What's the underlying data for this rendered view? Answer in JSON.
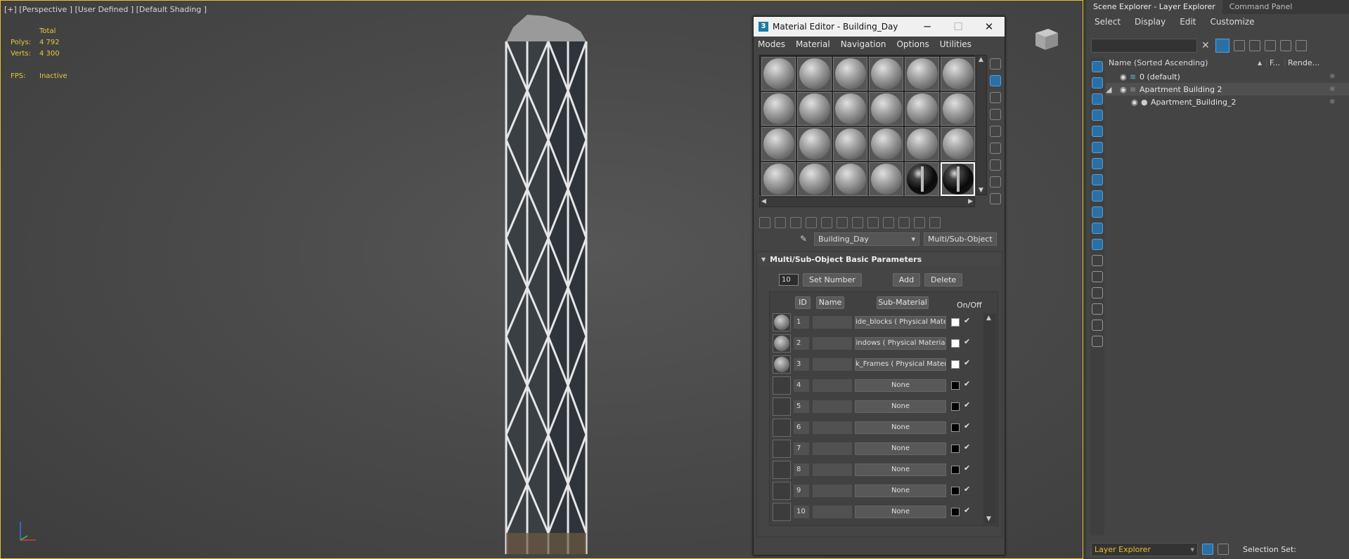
{
  "viewport": {
    "label": "[+] [Perspective ] [User Defined ] [Default Shading ]",
    "stats": {
      "total_label": "Total",
      "polys_label": "Polys:",
      "polys_value": "4 792",
      "verts_label": "Verts:",
      "verts_value": "4 300",
      "fps_label": "FPS:",
      "fps_value": "Inactive"
    }
  },
  "material_editor": {
    "title": "Material Editor - Building_Day",
    "logo": "3",
    "menu": [
      "Modes",
      "Material",
      "Navigation",
      "Options",
      "Utilities"
    ],
    "material_name": "Building_Day",
    "material_type": "Multi/Sub-Object",
    "rollout_title": "Multi/Sub-Object Basic Parameters",
    "set_number_value": "10",
    "set_number_label": "Set Number",
    "add_label": "Add",
    "delete_label": "Delete",
    "columns": {
      "id": "ID",
      "name": "Name",
      "sub_material": "Sub-Material",
      "on_off": "On/Off"
    },
    "rows": [
      {
        "id": "1",
        "sub": "ide_blocks  ( Physical Mater",
        "color": "#ffffff",
        "has_ball": true
      },
      {
        "id": "2",
        "sub": "indows  ( Physical Materia",
        "color": "#ffffff",
        "has_ball": true
      },
      {
        "id": "3",
        "sub": "k_Frames  ( Physical Mater",
        "color": "#ffffff",
        "has_ball": true
      },
      {
        "id": "4",
        "sub": "None",
        "color": "#000000",
        "has_ball": false
      },
      {
        "id": "5",
        "sub": "None",
        "color": "#000000",
        "has_ball": false
      },
      {
        "id": "6",
        "sub": "None",
        "color": "#000000",
        "has_ball": false
      },
      {
        "id": "7",
        "sub": "None",
        "color": "#000000",
        "has_ball": false
      },
      {
        "id": "8",
        "sub": "None",
        "color": "#000000",
        "has_ball": false
      },
      {
        "id": "9",
        "sub": "None",
        "color": "#000000",
        "has_ball": false
      },
      {
        "id": "10",
        "sub": "None",
        "color": "#000000",
        "has_ball": false
      }
    ],
    "check_glyph": "✔"
  },
  "scene_explorer": {
    "tabs": [
      "Scene Explorer - Layer Explorer",
      "Command Panel"
    ],
    "menu": [
      "Select",
      "Display",
      "Edit",
      "Customize"
    ],
    "col_name": "Name (Sorted Ascending)",
    "col_sort": "▲",
    "col_f": "F...",
    "col_render": "Rende...",
    "items": [
      {
        "label": "0 (default)"
      },
      {
        "label": "Apartment Building 2"
      },
      {
        "label": "Apartment_Building_2"
      }
    ],
    "bottom_dropdown": "Layer Explorer",
    "selection_set": "Selection Set:"
  },
  "colors": {
    "accent_yellow": "#e8c12a",
    "active_blue": "#2a6fa5"
  }
}
